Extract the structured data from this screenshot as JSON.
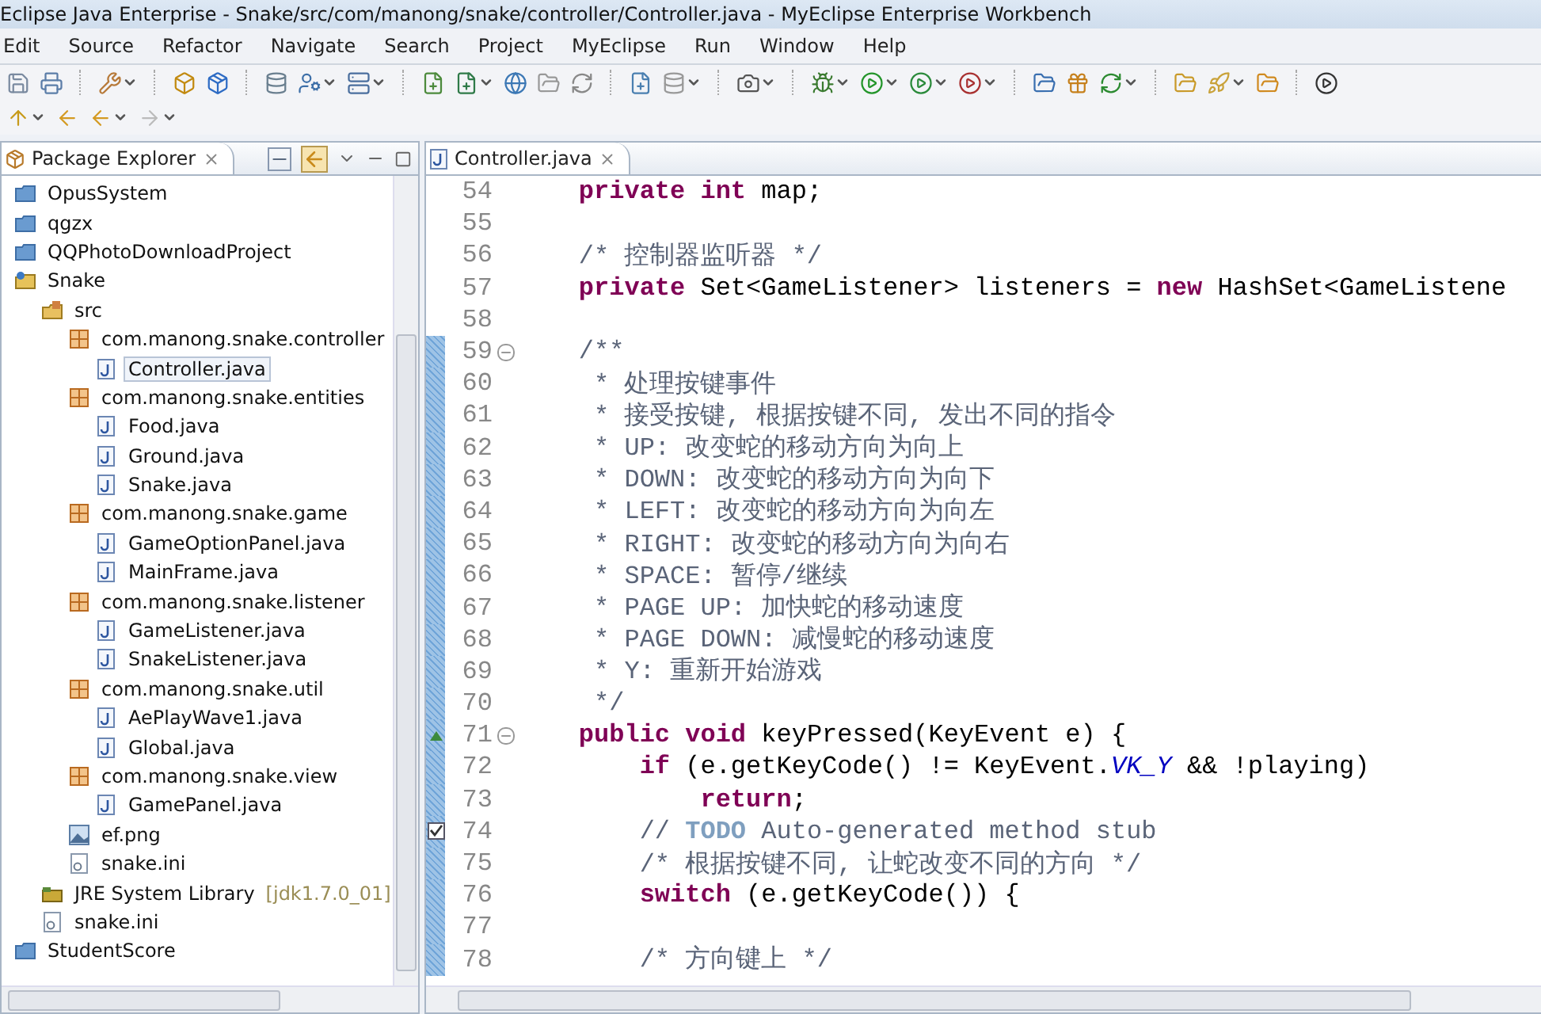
{
  "window": {
    "title": "Eclipse Java Enterprise - Snake/src/com/manong/snake/controller/Controller.java - MyEclipse Enterprise Workbench"
  },
  "menu": [
    "Edit",
    "Source",
    "Refactor",
    "Navigate",
    "Search",
    "Project",
    "MyEclipse",
    "Run",
    "Window",
    "Help"
  ],
  "package_explorer": {
    "title": "Package Explorer",
    "items": [
      {
        "label": "OpusSystem",
        "kind": "project",
        "selected": false
      },
      {
        "label": "qgzx",
        "kind": "project",
        "selected": false
      },
      {
        "label": "QQPhotoDownloadProject",
        "kind": "project",
        "selected": false
      },
      {
        "label": "Snake",
        "kind": "java-project",
        "selected": false,
        "children": [
          {
            "label": "src",
            "kind": "source-folder",
            "selected": false,
            "children": [
              {
                "label": "com.manong.snake.controller",
                "kind": "package",
                "selected": false,
                "children": [
                  {
                    "label": "Controller.java",
                    "kind": "java",
                    "selected": true
                  }
                ]
              },
              {
                "label": "com.manong.snake.entities",
                "kind": "package",
                "selected": false,
                "children": [
                  {
                    "label": "Food.java",
                    "kind": "java",
                    "selected": false
                  },
                  {
                    "label": "Ground.java",
                    "kind": "java",
                    "selected": false
                  },
                  {
                    "label": "Snake.java",
                    "kind": "java",
                    "selected": false
                  }
                ]
              },
              {
                "label": "com.manong.snake.game",
                "kind": "package",
                "selected": false,
                "children": [
                  {
                    "label": "GameOptionPanel.java",
                    "kind": "java",
                    "selected": false
                  },
                  {
                    "label": "MainFrame.java",
                    "kind": "java",
                    "selected": false
                  }
                ]
              },
              {
                "label": "com.manong.snake.listener",
                "kind": "package",
                "selected": false,
                "children": [
                  {
                    "label": "GameListener.java",
                    "kind": "java",
                    "selected": false
                  },
                  {
                    "label": "SnakeListener.java",
                    "kind": "java",
                    "selected": false
                  }
                ]
              },
              {
                "label": "com.manong.snake.util",
                "kind": "package",
                "selected": false,
                "children": [
                  {
                    "label": "AePlayWave1.java",
                    "kind": "java",
                    "selected": false
                  },
                  {
                    "label": "Global.java",
                    "kind": "java",
                    "selected": false
                  }
                ]
              },
              {
                "label": "com.manong.snake.view",
                "kind": "package",
                "selected": false,
                "children": [
                  {
                    "label": "GamePanel.java",
                    "kind": "java",
                    "selected": false
                  }
                ]
              },
              {
                "label": "ef.png",
                "kind": "image",
                "selected": false
              },
              {
                "label": "snake.ini",
                "kind": "file",
                "selected": false
              }
            ]
          },
          {
            "label": "JRE System Library",
            "decoration": "[jdk1.7.0_01]",
            "kind": "library",
            "selected": false
          },
          {
            "label": "snake.ini",
            "kind": "file",
            "selected": false
          }
        ]
      },
      {
        "label": "StudentScore",
        "kind": "project",
        "selected": false
      }
    ]
  },
  "editor": {
    "tab": "Controller.java",
    "lines": [
      {
        "number": "54",
        "changed": false,
        "tokens": [
          {
            "kind": "keyword",
            "text": "    private int"
          },
          {
            "kind": "plain",
            "text": " map;"
          }
        ]
      },
      {
        "number": "55",
        "changed": false
      },
      {
        "number": "56",
        "changed": false,
        "tokens": [
          {
            "kind": "comment",
            "text": "    /* 控制器监听器 */"
          }
        ]
      },
      {
        "number": "57",
        "changed": false,
        "tokens": [
          {
            "kind": "keyword",
            "text": "    private"
          },
          {
            "kind": "plain",
            "text": " Set<GameListener> listeners = "
          },
          {
            "kind": "keyword",
            "text": "new"
          },
          {
            "kind": "plain",
            "text": " HashSet<GameListene"
          }
        ]
      },
      {
        "number": "58",
        "changed": false
      },
      {
        "number": "59",
        "changed": true,
        "fold": true,
        "tokens": [
          {
            "kind": "comment",
            "text": "    /**"
          }
        ]
      },
      {
        "number": "60",
        "changed": true,
        "tokens": [
          {
            "kind": "comment",
            "text": "     * 处理按键事件"
          }
        ]
      },
      {
        "number": "61",
        "changed": true,
        "tokens": [
          {
            "kind": "comment",
            "text": "     * 接受按键, 根据按键不同, 发出不同的指令"
          }
        ]
      },
      {
        "number": "62",
        "changed": true,
        "tokens": [
          {
            "kind": "comment",
            "text": "     * UP: 改变蛇的移动方向为向上"
          }
        ]
      },
      {
        "number": "63",
        "changed": true,
        "tokens": [
          {
            "kind": "comment",
            "text": "     * DOWN: 改变蛇的移动方向为向下"
          }
        ]
      },
      {
        "number": "64",
        "changed": true,
        "tokens": [
          {
            "kind": "comment",
            "text": "     * LEFT: 改变蛇的移动方向为向左"
          }
        ]
      },
      {
        "number": "65",
        "changed": true,
        "tokens": [
          {
            "kind": "comment",
            "text": "     * RIGHT: 改变蛇的移动方向为向右"
          }
        ]
      },
      {
        "number": "66",
        "changed": true,
        "tokens": [
          {
            "kind": "comment",
            "text": "     * SPACE: 暂停/继续"
          }
        ]
      },
      {
        "number": "67",
        "changed": true,
        "tokens": [
          {
            "kind": "comment",
            "text": "     * PAGE UP: 加快蛇的移动速度"
          }
        ]
      },
      {
        "number": "68",
        "changed": true,
        "tokens": [
          {
            "kind": "comment",
            "text": "     * PAGE DOWN: 减慢蛇的移动速度"
          }
        ]
      },
      {
        "number": "69",
        "changed": true,
        "tokens": [
          {
            "kind": "comment",
            "text": "     * Y: 重新开始游戏"
          }
        ]
      },
      {
        "number": "70",
        "changed": true,
        "tokens": [
          {
            "kind": "comment",
            "text": "     */"
          }
        ]
      },
      {
        "number": "71",
        "changed": true,
        "fold": true,
        "override": true,
        "tokens": [
          {
            "kind": "keyword",
            "text": "    public void"
          },
          {
            "kind": "plain",
            "text": " keyPressed(KeyEvent e) {"
          }
        ]
      },
      {
        "number": "72",
        "changed": true,
        "tokens": [
          {
            "kind": "keyword",
            "text": "        if"
          },
          {
            "kind": "plain",
            "text": " (e.getKeyCode() != KeyEvent."
          },
          {
            "kind": "static",
            "text": "VK_Y"
          },
          {
            "kind": "plain",
            "text": " && !playing)"
          }
        ]
      },
      {
        "number": "73",
        "changed": true,
        "tokens": [
          {
            "kind": "keyword",
            "text": "            return"
          },
          {
            "kind": "plain",
            "text": ";"
          }
        ]
      },
      {
        "number": "74",
        "changed": true,
        "task": true,
        "tokens": [
          {
            "kind": "comment",
            "text": "        // "
          },
          {
            "kind": "task",
            "text": "TODO"
          },
          {
            "kind": "comment",
            "text": " Auto-generated method stub"
          }
        ]
      },
      {
        "number": "75",
        "changed": true,
        "tokens": [
          {
            "kind": "comment",
            "text": "        /* 根据按键不同, 让蛇改变不同的方向 */"
          }
        ]
      },
      {
        "number": "76",
        "changed": true,
        "tokens": [
          {
            "kind": "keyword",
            "text": "        switch"
          },
          {
            "kind": "plain",
            "text": " (e.getKeyCode()) {"
          }
        ]
      },
      {
        "number": "77",
        "changed": true
      },
      {
        "number": "78",
        "changed": true,
        "tokens": [
          {
            "kind": "comment",
            "text": "        /* 方向键上 */"
          }
        ]
      }
    ]
  }
}
